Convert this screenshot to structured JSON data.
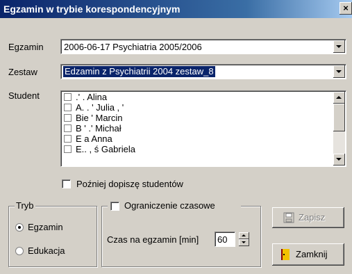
{
  "window": {
    "title": "Egzamin w trybie korespondencyjnym",
    "close_glyph": "×"
  },
  "egzamin": {
    "label": "Egzamin",
    "value": "2006-06-17 Psychiatria 2005/2006"
  },
  "zestaw": {
    "label": "Zestaw",
    "value": "Edzamin z Psychiatrii 2004 zestaw_8"
  },
  "student": {
    "label": "Student",
    "items": [
      {
        "label": ".'  .     Alina",
        "checked": false
      },
      {
        "label": "A.   .       '  Julia  ,   '",
        "checked": false
      },
      {
        "label": "Bie      '  Marcin",
        "checked": false
      },
      {
        "label": "B  '  .'  Michał",
        "checked": false
      },
      {
        "label": "E    a Anna",
        "checked": false
      },
      {
        "label": "E.. , ś Gabriela",
        "checked": false
      }
    ]
  },
  "later": {
    "label": "Poźniej dopiszę studentów",
    "checked": false
  },
  "tryb": {
    "label": "Tryb",
    "options": [
      {
        "label": "Egzamin",
        "selected": true
      },
      {
        "label": "Edukacja",
        "selected": false
      }
    ]
  },
  "limit": {
    "label": "Ograniczenie czasowe",
    "checked": false,
    "time_label": "Czas na egzamin [min]",
    "time_value": "60"
  },
  "buttons": {
    "save": "Zapisz",
    "close": "Zamknij"
  },
  "colors": {
    "face": "#d4d0c8",
    "selection": "#0a246a",
    "title_start": "#0a246a",
    "title_end": "#a6caf0"
  }
}
